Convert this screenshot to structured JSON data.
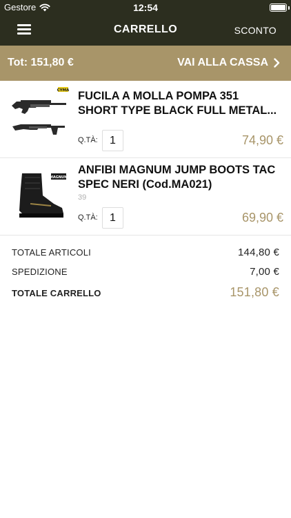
{
  "status_bar": {
    "carrier": "Gestore",
    "time": "12:54"
  },
  "nav": {
    "title": "CARRELLO",
    "discount": "SCONTO"
  },
  "checkout": {
    "total": "Tot: 151,80 €",
    "button": "VAI ALLA CASSA"
  },
  "cart": {
    "items": [
      {
        "name_line1": "FUCILA A MOLLA POMPA 351",
        "name_line2": "SHORT TYPE BLACK FULL METAL...",
        "qty_label": "Q.TÀ:",
        "qty": "1",
        "price": "74,90 €",
        "image": "shotgun-airsoft"
      },
      {
        "name_line1": "ANFIBI MAGNUM JUMP BOOTS TAC",
        "name_line2": "SPEC NERI (Cod.MA021)",
        "size": "39",
        "qty_label": "Q.TÀ:",
        "qty": "1",
        "price": "69,90 €",
        "image": "black-tactical-boot"
      }
    ]
  },
  "summary": {
    "items_label": "TOTALE ARTICOLI",
    "items_value": "144,80 €",
    "shipping_label": "SPEDIZIONE",
    "shipping_value": "7,00 €",
    "total_label": "TOTALE CARRELLO",
    "total_value": "151,80 €"
  },
  "colors": {
    "header": "#2c2e1f",
    "accent": "#a89569"
  }
}
